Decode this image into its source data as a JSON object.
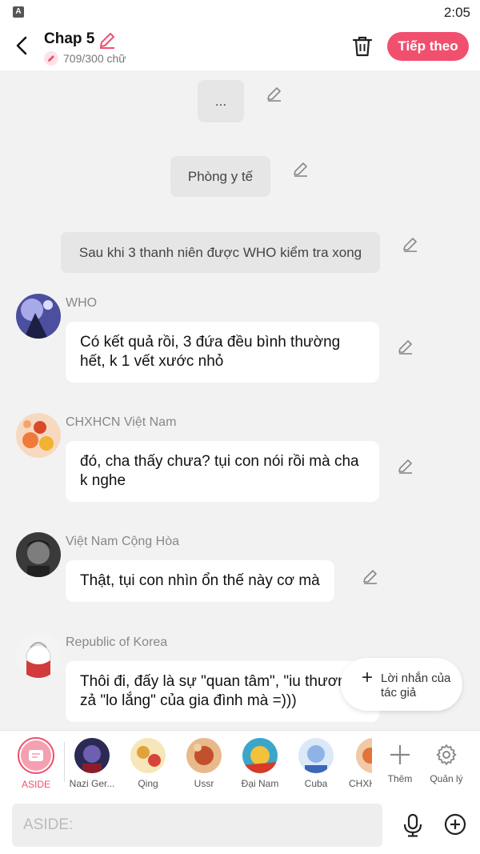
{
  "status": {
    "time": "2:05",
    "app_letter": "A"
  },
  "header": {
    "title": "Chap 5",
    "word_count": "709/300 chữ",
    "next_label": "Tiếp theo"
  },
  "messages": {
    "narration1": "...",
    "narration2": "Phòng y tế",
    "narration3": "Sau khi 3 thanh niên được WHO kiểm tra xong",
    "who": {
      "name": "WHO",
      "text": "Có kết quả rồi, 3 đứa đều bình thường hết, k 1 vết xước nhỏ"
    },
    "vn": {
      "name": "CHXHCN Việt Nam",
      "text": "đó, cha thấy chưa? tụi con nói rồi mà cha k nghe"
    },
    "vnch": {
      "name": "Việt Nam Cộng Hòa",
      "text": "Thật, tụi con nhìn ổn thế này cơ mà"
    },
    "rok": {
      "name": "Republic of Korea",
      "text": "Thôi đi, đấy là sự \"quan tâm\", \"iu thương\" zả \"lo lắng\" của gia đình mà =)))"
    }
  },
  "author_note": {
    "label": "Lời nhắn của tác giả"
  },
  "charbar": {
    "items": [
      "ASIDE",
      "Nazi Ger...",
      "Qing",
      "Ussr",
      "Đại Nam",
      "Cuba",
      "CHXHCN"
    ],
    "add_label": "Thêm",
    "manage_label": "Quản lý"
  },
  "input": {
    "placeholder": "ASIDE:"
  },
  "colors": {
    "accent": "#f0506e",
    "bubble_gray": "#e6e6e6",
    "bg": "#f2f2f2"
  }
}
